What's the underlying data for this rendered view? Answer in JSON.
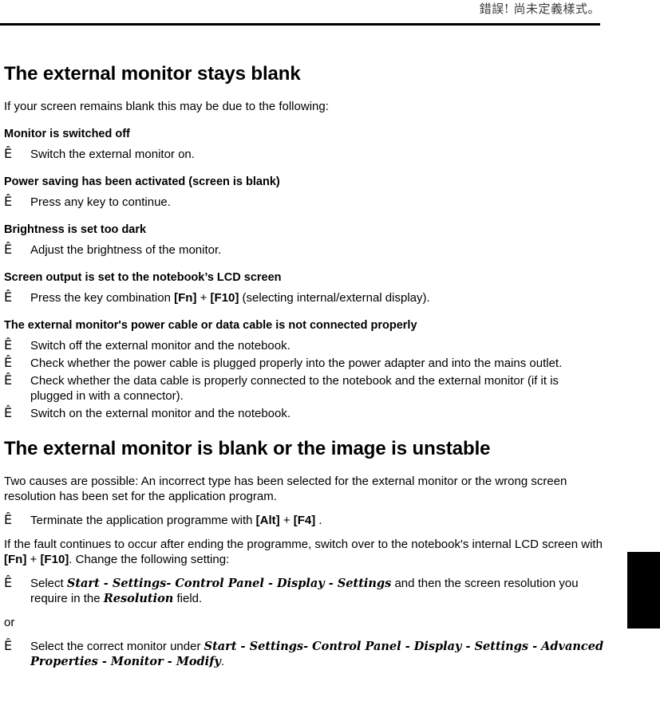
{
  "header": {
    "text": "錯誤! 尚未定義樣式。"
  },
  "sections": [
    {
      "heading": "The external monitor stays blank",
      "intro": "If your screen remains blank this may be due to the following:",
      "groups": [
        {
          "subheading": "Monitor is switched off",
          "steps": [
            {
              "marker": "Ê",
              "text": "Switch the external monitor on."
            }
          ]
        },
        {
          "subheading": "Power saving has been activated (screen is blank)",
          "steps": [
            {
              "marker": "Ê",
              "text": "Press any key to continue."
            }
          ]
        },
        {
          "subheading": "Brightness is set too dark",
          "steps": [
            {
              "marker": "Ê",
              "text": "Adjust the brightness of the monitor."
            }
          ]
        },
        {
          "subheading": "Screen output is set to the notebook’s LCD screen",
          "steps": [
            {
              "marker": "Ê",
              "before": "Press the key combination ",
              "key1": "[Fn]",
              "plus": " + ",
              "key2": "[F10]",
              "after": " (selecting internal/external display)."
            }
          ]
        },
        {
          "subheading": "The external monitor's power cable or data cable is not connected properly",
          "steps": [
            {
              "marker": "Ê",
              "text": "Switch off the external monitor and the notebook."
            },
            {
              "marker": "Ê",
              "text": "Check whether the power cable is plugged properly into the power adapter and into the mains outlet."
            },
            {
              "marker": "Ê",
              "text": "Check whether the data cable is properly connected to the notebook and the external monitor (if it is plugged in with a connector)."
            },
            {
              "marker": "Ê",
              "text": "Switch on the external monitor and the notebook."
            }
          ]
        }
      ]
    },
    {
      "heading": "The external monitor is blank or the image is unstable",
      "intro": "Two causes are possible: An incorrect type has been selected for the external monitor or the wrong screen resolution has been set for the application program.",
      "step_alt": {
        "marker": "Ê",
        "before": "Terminate the application programme with ",
        "key1": "[Alt]",
        "plus": " + ",
        "key2": "[F4]",
        "after": "."
      },
      "paragraph2": {
        "before": "If the fault continues to occur after ending the programme, switch over to the notebook's internal LCD screen with ",
        "key1": "[Fn]",
        "plus": " + ",
        "key2": "[F10]",
        "after": ". Change the following setting:"
      },
      "step_select": {
        "marker": "Ê",
        "before": "Select ",
        "path1": "Start - Settings- Control Panel - Display - Settings",
        "middle": " and then the screen resolution you require in the ",
        "path2": "Resolution",
        "after": " field."
      },
      "or_label": "or",
      "step_monitor": {
        "marker": "Ê",
        "before": "Select the correct monitor under ",
        "path1": "Start - Settings- Control Panel - Display  - Settings - Advanced Properties - Monitor - Modify",
        "after": "."
      }
    }
  ],
  "colors": {
    "text": "#000000",
    "header_text": "#3a3a3a",
    "rule": "#000000",
    "thumb_tab": "#000000"
  }
}
